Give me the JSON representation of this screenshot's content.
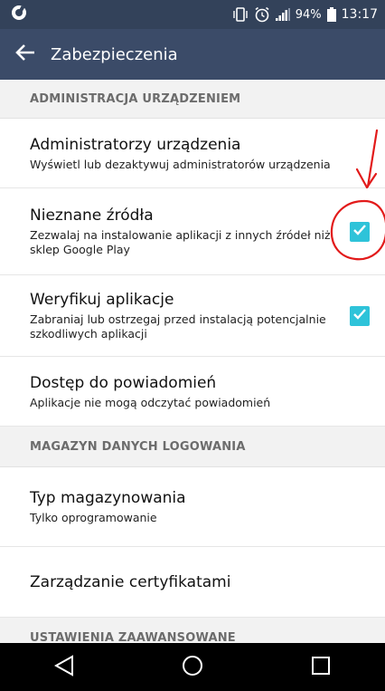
{
  "status_bar": {
    "battery": "94%",
    "time": "13:17"
  },
  "app_bar": {
    "title": "Zabezpieczenia"
  },
  "sections": {
    "admin": {
      "header": "ADMINISTRACJA URZĄDZENIEM",
      "device_admins": {
        "title": "Administratorzy urządzenia",
        "summary": "Wyświetl lub dezaktywuj administratorów urządzenia"
      },
      "unknown_sources": {
        "title": "Nieznane źródła",
        "summary": "Zezwalaj na instalowanie aplikacji z innych źródeł niż sklep Google Play",
        "checked": true
      },
      "verify_apps": {
        "title": "Weryfikuj aplikacje",
        "summary": "Zabraniaj lub ostrzegaj przed instalacją potencjalnie szkodliwych aplikacji",
        "checked": true
      },
      "notification_access": {
        "title": "Dostęp do powiadomień",
        "summary": "Aplikacje nie mogą odczytać powiadomień"
      }
    },
    "credentials": {
      "header": "MAGAZYN DANYCH LOGOWANIA",
      "storage_type": {
        "title": "Typ magazynowania",
        "summary": "Tylko oprogramowanie"
      },
      "cert_management": {
        "title": "Zarządzanie certyfikatami"
      }
    },
    "advanced": {
      "header": "USTAWIENIA ZAAWANSOWANE"
    }
  },
  "colors": {
    "status_bar": "#33425a",
    "app_bar": "#3b4b68",
    "checkbox": "#2ec3d9",
    "annotation": "#e21a1a"
  },
  "icons": {
    "back": "arrow-left-icon",
    "nav_back": "triangle-back-icon",
    "nav_home": "circle-home-icon",
    "nav_recents": "square-recents-icon"
  }
}
